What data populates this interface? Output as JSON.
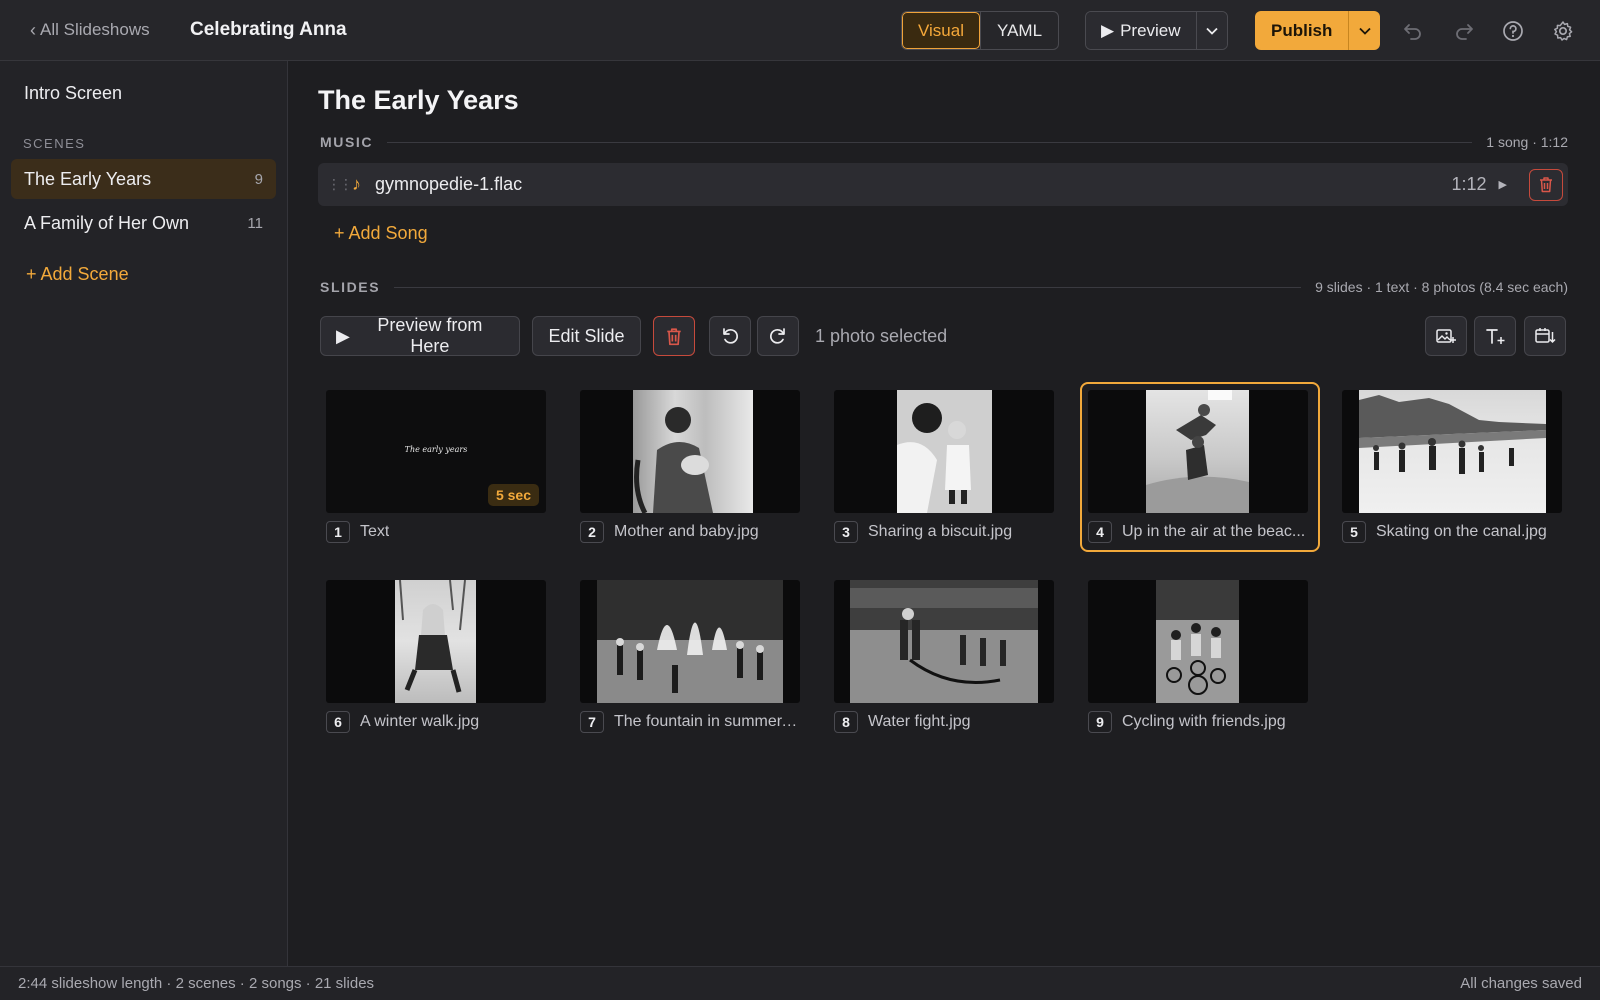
{
  "header": {
    "back_label": "All Slideshows",
    "title": "Celebrating Anna",
    "mode_tabs": [
      "Visual",
      "YAML"
    ],
    "active_mode": "Visual",
    "preview_label": "Preview",
    "publish_label": "Publish",
    "icons": [
      "undo-icon",
      "redo-icon",
      "help-icon",
      "settings-icon"
    ]
  },
  "sidebar": {
    "intro": "Intro Screen",
    "scenes_label": "SCENES",
    "scenes": [
      {
        "label": "The Early Years",
        "count": "9",
        "active": true
      },
      {
        "label": "A Family of Her Own",
        "count": "11",
        "active": false
      }
    ],
    "add_scene": "+ Add Scene"
  },
  "main": {
    "title": "The Early Years",
    "music": {
      "label": "MUSIC",
      "meta": "1 song · 1:12",
      "songs": [
        {
          "name": "gymnopedie-1.flac",
          "duration": "1:12"
        }
      ],
      "add_song": "+ Add Song"
    },
    "slides": {
      "label": "SLIDES",
      "meta": "9 slides · 1 text · 8 photos (8.4 sec each)",
      "toolbar": {
        "preview_from_here": "Preview from Here",
        "edit_slide": "Edit Slide",
        "selection_status": "1 photo selected"
      },
      "items": [
        {
          "num": "1",
          "name": "Text",
          "type": "text",
          "text": "The early years",
          "badge": "5 sec"
        },
        {
          "num": "2",
          "name": "Mother and baby.jpg",
          "type": "photo"
        },
        {
          "num": "3",
          "name": "Sharing a biscuit.jpg",
          "type": "photo"
        },
        {
          "num": "4",
          "name": "Up in the air at the beac...",
          "type": "photo",
          "selected": true
        },
        {
          "num": "5",
          "name": "Skating on the canal.jpg",
          "type": "photo"
        },
        {
          "num": "6",
          "name": "A winter walk.jpg",
          "type": "photo"
        },
        {
          "num": "7",
          "name": "The fountain in summer....",
          "type": "photo"
        },
        {
          "num": "8",
          "name": "Water fight.jpg",
          "type": "photo"
        },
        {
          "num": "9",
          "name": "Cycling with friends.jpg",
          "type": "photo"
        }
      ]
    }
  },
  "footer": {
    "summary": "2:44 slideshow length · 2 scenes · 2 songs · 21 slides",
    "save_status": "All changes saved"
  },
  "colors": {
    "accent": "#f2a93b",
    "danger": "#c64a3c",
    "background": "#1e1e21"
  }
}
